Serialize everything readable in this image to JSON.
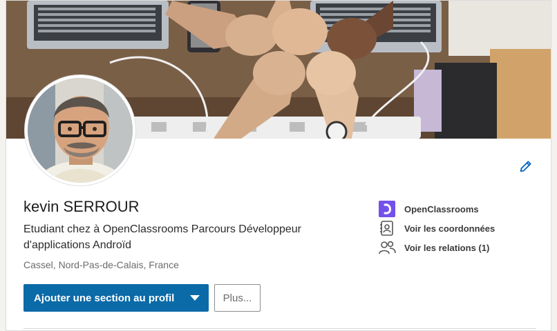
{
  "profile": {
    "name": "kevin SERROUR",
    "headline": "Etudiant chez à OpenClassrooms Parcours Développeur d'applications Androïd",
    "location": "Cassel, Nord-Pas-de-Calais, France"
  },
  "actions": {
    "primary_label": "Ajouter une section au profil",
    "more_label": "Plus..."
  },
  "side_links": [
    {
      "label": "OpenClassrooms",
      "icon": "openclassrooms-logo-icon"
    },
    {
      "label": "Voir les coordonnées",
      "icon": "contact-card-icon"
    },
    {
      "label": "Voir les relations (1)",
      "icon": "connections-icon"
    }
  ],
  "colors": {
    "primary_button": "#0b6aa8",
    "openclassrooms_brand": "#7451eb",
    "edit_icon": "#0a66c2"
  },
  "icons": {
    "edit": "pencil-icon",
    "dropdown": "caret-down-icon"
  }
}
